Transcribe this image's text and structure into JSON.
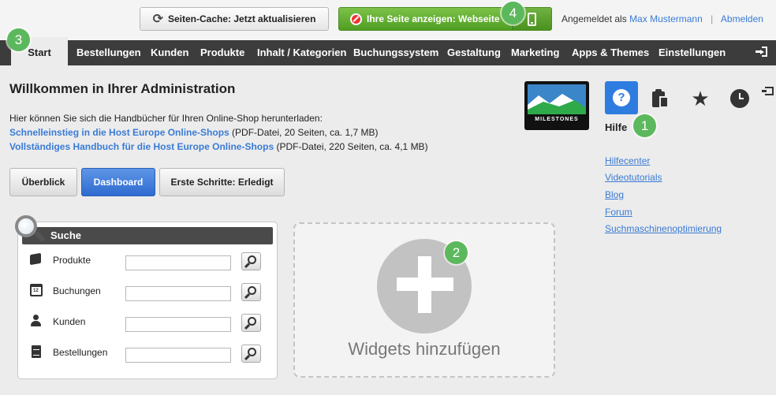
{
  "topbar": {
    "cache_button": "Seiten-Cache: Jetzt aktualisieren",
    "view_button": "Ihre Seite anzeigen: Webseite",
    "login_prefix": "Angemeldet als",
    "user_name": "Max Mustermann",
    "logout": "Abmelden"
  },
  "nav": {
    "items": [
      "Start",
      "Bestellungen",
      "Kunden",
      "Produkte",
      "Inhalt / Kategorien",
      "Buchungssystem",
      "Gestaltung",
      "Marketing",
      "Apps & Themes",
      "Einstellungen"
    ]
  },
  "badges": [
    "1",
    "2",
    "3",
    "4"
  ],
  "main": {
    "title": "Willkommen in Ihrer Administration",
    "intro": "Hier können Sie sich die Handbücher für Ihren Online-Shop herunterladen:",
    "manual1_link": "Schnelleinstieg in die Host Europe Online-Shops",
    "manual1_info": "(PDF-Datei, 20 Seiten, ca. 1,7 MB)",
    "manual2_link": "Vollständiges Handbuch für die Host Europe Online-Shops",
    "manual2_info": "(PDF-Datei, 220 Seiten, ca. 4,1 MB)",
    "tabs": [
      "Überblick",
      "Dashboard",
      "Erste Schritte: Erledigt"
    ]
  },
  "search": {
    "title": "Suche",
    "rows": [
      {
        "label": "Produkte",
        "icon": "box-icon"
      },
      {
        "label": "Buchungen",
        "icon": "calendar-icon"
      },
      {
        "label": "Kunden",
        "icon": "user-icon"
      },
      {
        "label": "Bestellungen",
        "icon": "document-icon"
      }
    ],
    "calendar_day": "12"
  },
  "widget": {
    "label": "Widgets hinzufügen"
  },
  "logo": {
    "text": "MILESTONES"
  },
  "help": {
    "title": "Hilfe",
    "links": [
      "Hilfecenter",
      "Videotutorials",
      "Blog",
      "Forum",
      "Suchmaschinenoptimierung"
    ]
  },
  "colors": {
    "accent": "#2f7ce0",
    "nav_bg": "#3c3c3c",
    "green": "#5cb85c",
    "link": "#3a7bd5"
  }
}
